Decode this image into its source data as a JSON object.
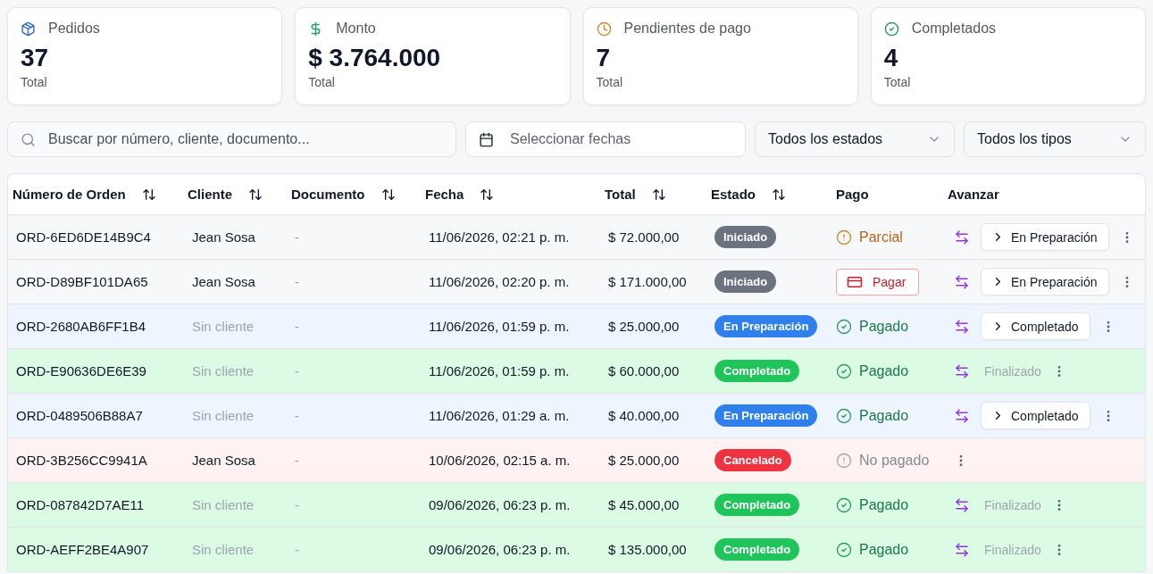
{
  "stats": [
    {
      "kind": "orders",
      "label": "Pedidos",
      "value": "37",
      "caption": "Total"
    },
    {
      "kind": "amount",
      "label": "Monto",
      "value": "$ 3.764.000",
      "caption": "Total"
    },
    {
      "kind": "pending",
      "label": "Pendientes de pago",
      "value": "7",
      "caption": "Total"
    },
    {
      "kind": "completed",
      "label": "Completados",
      "value": "4",
      "caption": "Total"
    }
  ],
  "filters": {
    "search": {
      "placeholder": "Buscar por número, cliente, documento..."
    },
    "date_range": {
      "placeholder": "Seleccionar fechas"
    },
    "status_select": {
      "value": "Todos los estados"
    },
    "type_select": {
      "value": "Todos los tipos"
    }
  },
  "table": {
    "columns": [
      {
        "label": "Número de Orden",
        "sortable": true
      },
      {
        "label": "Cliente",
        "sortable": true
      },
      {
        "label": "Documento",
        "sortable": true
      },
      {
        "label": "Fecha",
        "sortable": true
      },
      {
        "label": "Total",
        "sortable": true
      },
      {
        "label": "Estado",
        "sortable": true
      },
      {
        "label": "Pago",
        "sortable": false
      },
      {
        "label": "Avanzar",
        "sortable": false
      }
    ],
    "rows": [
      {
        "order": "ORD-6ED6DE14B9C4",
        "client": "Jean Sosa",
        "client_assigned": true,
        "document": "-",
        "date": "11/06/2026, 02:21 p. m.",
        "total": "$ 72.000,00",
        "status": {
          "kind": "started",
          "label": "Iniciado"
        },
        "payment": {
          "kind": "partial",
          "label": "Parcial"
        },
        "advance": {
          "kind": "button",
          "label": "En Preparación"
        }
      },
      {
        "order": "ORD-D89BF101DA65",
        "client": "Jean Sosa",
        "client_assigned": true,
        "document": "-",
        "date": "11/06/2026, 02:20 p. m.",
        "total": "$ 171.000,00",
        "status": {
          "kind": "started",
          "label": "Iniciado"
        },
        "payment": {
          "kind": "pay_button",
          "label": "Pagar"
        },
        "advance": {
          "kind": "button",
          "label": "En Preparación"
        }
      },
      {
        "order": "ORD-2680AB6FF1B4",
        "client": "Sin cliente",
        "client_assigned": false,
        "document": "-",
        "date": "11/06/2026, 01:59 p. m.",
        "total": "$ 25.000,00",
        "status": {
          "kind": "preparing",
          "label": "En Preparación"
        },
        "payment": {
          "kind": "paid",
          "label": "Pagado"
        },
        "advance": {
          "kind": "button",
          "label": "Completado"
        }
      },
      {
        "order": "ORD-E90636DE6E39",
        "client": "Sin cliente",
        "client_assigned": false,
        "document": "-",
        "date": "11/06/2026, 01:59 p. m.",
        "total": "$ 60.000,00",
        "status": {
          "kind": "completed",
          "label": "Completado"
        },
        "payment": {
          "kind": "paid",
          "label": "Pagado"
        },
        "advance": {
          "kind": "finished",
          "label": "Finalizado"
        }
      },
      {
        "order": "ORD-0489506B88A7",
        "client": "Sin cliente",
        "client_assigned": false,
        "document": "-",
        "date": "11/06/2026, 01:29 a. m.",
        "total": "$ 40.000,00",
        "status": {
          "kind": "preparing",
          "label": "En Preparación"
        },
        "payment": {
          "kind": "paid",
          "label": "Pagado"
        },
        "advance": {
          "kind": "button",
          "label": "Completado"
        }
      },
      {
        "order": "ORD-3B256CC9941A",
        "client": "Jean Sosa",
        "client_assigned": true,
        "document": "-",
        "date": "10/06/2026, 02:15 a. m.",
        "total": "$ 25.000,00",
        "status": {
          "kind": "cancelled",
          "label": "Cancelado"
        },
        "payment": {
          "kind": "unpaid",
          "label": "No pagado"
        }
      },
      {
        "order": "ORD-087842D7AE11",
        "client": "Sin cliente",
        "client_assigned": false,
        "document": "-",
        "date": "09/06/2026, 06:23 p. m.",
        "total": "$ 45.000,00",
        "status": {
          "kind": "completed",
          "label": "Completado"
        },
        "payment": {
          "kind": "paid",
          "label": "Pagado"
        },
        "advance": {
          "kind": "finished",
          "label": "Finalizado"
        }
      },
      {
        "order": "ORD-AEFF2BE4A907",
        "client": "Sin cliente",
        "client_assigned": false,
        "document": "-",
        "date": "09/06/2026, 06:23 p. m.",
        "total": "$ 135.000,00",
        "status": {
          "kind": "completed",
          "label": "Completado"
        },
        "payment": {
          "kind": "paid",
          "label": "Pagado"
        },
        "advance": {
          "kind": "finished",
          "label": "Finalizado"
        }
      }
    ]
  }
}
